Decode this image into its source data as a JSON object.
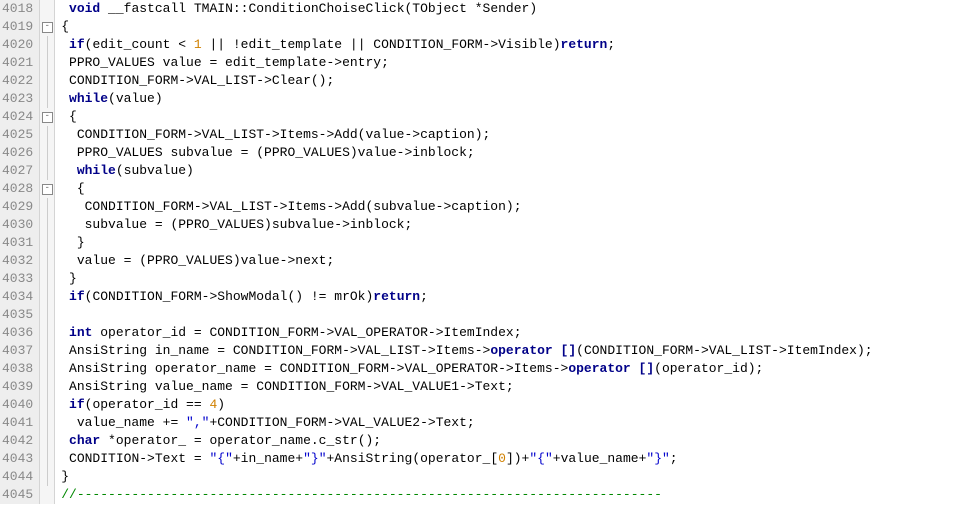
{
  "editor": {
    "first_line": 4018,
    "lines": [
      {
        "indent": " ",
        "fold": "",
        "tokens": [
          [
            "kw",
            "void"
          ],
          [
            "",
            " __fastcall TMAIN::ConditionChoiseClick(TObject *Sender)"
          ]
        ]
      },
      {
        "indent": "",
        "fold": "sq",
        "tokens": [
          [
            "",
            "{"
          ]
        ]
      },
      {
        "indent": " ",
        "fold": "bar",
        "tokens": [
          [
            "kw",
            "if"
          ],
          [
            "",
            "(edit_count < "
          ],
          [
            "num",
            "1"
          ],
          [
            "",
            " || !edit_template || CONDITION_FORM->Visible)"
          ],
          [
            "kw",
            "return"
          ],
          [
            "",
            ";"
          ]
        ]
      },
      {
        "indent": " ",
        "fold": "bar",
        "tokens": [
          [
            "",
            "PPRO_VALUES value = edit_template->entry;"
          ]
        ]
      },
      {
        "indent": " ",
        "fold": "bar",
        "tokens": [
          [
            "",
            "CONDITION_FORM->VAL_LIST->Clear();"
          ]
        ]
      },
      {
        "indent": " ",
        "fold": "bar",
        "tokens": [
          [
            "kw",
            "while"
          ],
          [
            "",
            "(value)"
          ]
        ]
      },
      {
        "indent": " ",
        "fold": "sq",
        "tokens": [
          [
            "",
            "{"
          ]
        ]
      },
      {
        "indent": "  ",
        "fold": "bar",
        "tokens": [
          [
            "",
            "CONDITION_FORM->VAL_LIST->Items->Add(value->caption);"
          ]
        ]
      },
      {
        "indent": "  ",
        "fold": "bar",
        "tokens": [
          [
            "",
            "PPRO_VALUES subvalue = (PPRO_VALUES)value->inblock;"
          ]
        ]
      },
      {
        "indent": "  ",
        "fold": "bar",
        "tokens": [
          [
            "kw",
            "while"
          ],
          [
            "",
            "(subvalue)"
          ]
        ]
      },
      {
        "indent": "  ",
        "fold": "sq",
        "tokens": [
          [
            "",
            "{"
          ]
        ]
      },
      {
        "indent": "   ",
        "fold": "bar",
        "tokens": [
          [
            "",
            "CONDITION_FORM->VAL_LIST->Items->Add(subvalue->caption);"
          ]
        ]
      },
      {
        "indent": "   ",
        "fold": "bar",
        "tokens": [
          [
            "",
            "subvalue = (PPRO_VALUES)subvalue->inblock;"
          ]
        ]
      },
      {
        "indent": "  ",
        "fold": "bar",
        "tokens": [
          [
            "",
            "}"
          ]
        ]
      },
      {
        "indent": "  ",
        "fold": "bar",
        "tokens": [
          [
            "",
            "value = (PPRO_VALUES)value->next;"
          ]
        ]
      },
      {
        "indent": " ",
        "fold": "bar",
        "tokens": [
          [
            "",
            "}"
          ]
        ]
      },
      {
        "indent": " ",
        "fold": "bar",
        "tokens": [
          [
            "kw",
            "if"
          ],
          [
            "",
            "(CONDITION_FORM->ShowModal() != mrOk)"
          ],
          [
            "kw",
            "return"
          ],
          [
            "",
            ";"
          ]
        ]
      },
      {
        "indent": " ",
        "fold": "bar",
        "tokens": [
          [
            "",
            ""
          ]
        ]
      },
      {
        "indent": " ",
        "fold": "bar",
        "tokens": [
          [
            "kw",
            "int"
          ],
          [
            "",
            " operator_id = CONDITION_FORM->VAL_OPERATOR->ItemIndex;"
          ]
        ]
      },
      {
        "indent": " ",
        "fold": "bar",
        "tokens": [
          [
            "",
            "AnsiString in_name = CONDITION_FORM->VAL_LIST->Items->"
          ],
          [
            "kw",
            "operator []"
          ],
          [
            "",
            "(CONDITION_FORM->VAL_LIST->ItemIndex);"
          ]
        ]
      },
      {
        "indent": " ",
        "fold": "bar",
        "tokens": [
          [
            "",
            "AnsiString operator_name = CONDITION_FORM->VAL_OPERATOR->Items->"
          ],
          [
            "kw",
            "operator []"
          ],
          [
            "",
            "(operator_id);"
          ]
        ]
      },
      {
        "indent": " ",
        "fold": "bar",
        "tokens": [
          [
            "",
            "AnsiString value_name = CONDITION_FORM->VAL_VALUE1->Text;"
          ]
        ]
      },
      {
        "indent": " ",
        "fold": "bar",
        "tokens": [
          [
            "kw",
            "if"
          ],
          [
            "",
            "(operator_id == "
          ],
          [
            "num",
            "4"
          ],
          [
            "",
            ")"
          ]
        ]
      },
      {
        "indent": "  ",
        "fold": "bar",
        "tokens": [
          [
            "",
            "value_name += "
          ],
          [
            "str",
            "\",\""
          ],
          [
            "",
            "+CONDITION_FORM->VAL_VALUE2->Text;"
          ]
        ]
      },
      {
        "indent": " ",
        "fold": "bar",
        "tokens": [
          [
            "kw",
            "char"
          ],
          [
            "",
            " *operator_ = operator_name.c_str();"
          ]
        ]
      },
      {
        "indent": " ",
        "fold": "bar",
        "tokens": [
          [
            "",
            "CONDITION->Text = "
          ],
          [
            "str",
            "\"{\""
          ],
          [
            "",
            "+in_name+"
          ],
          [
            "str",
            "\"}\""
          ],
          [
            "",
            "+AnsiString(operator_["
          ],
          [
            "num",
            "0"
          ],
          [
            "",
            "])+"
          ],
          [
            "str",
            "\"{\""
          ],
          [
            "",
            "+value_name+"
          ],
          [
            "str",
            "\"}\""
          ],
          [
            "",
            ";"
          ]
        ]
      },
      {
        "indent": "",
        "fold": "bar",
        "tokens": [
          [
            "",
            "}"
          ]
        ]
      },
      {
        "indent": "",
        "fold": "",
        "tokens": [
          [
            "cmt",
            "//---------------------------------------------------------------------------"
          ]
        ]
      }
    ]
  }
}
